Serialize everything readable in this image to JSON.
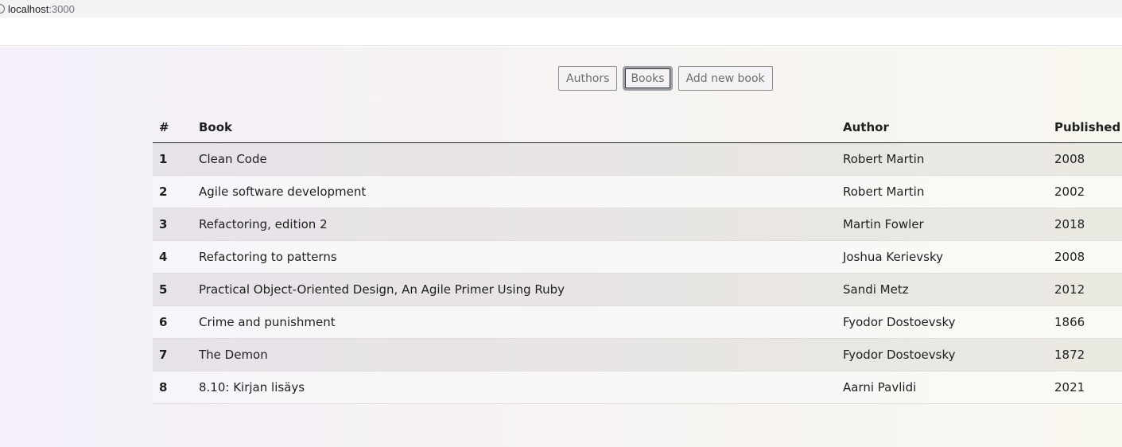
{
  "browser": {
    "url_host": "localhost",
    "url_port": ":3000"
  },
  "nav": {
    "authors_label": "Authors",
    "books_label": "Books",
    "add_book_label": "Add new book"
  },
  "table": {
    "headers": {
      "num": "#",
      "book": "Book",
      "author": "Author",
      "published": "Published"
    },
    "rows": [
      {
        "num": "1",
        "book": "Clean Code",
        "author": "Robert Martin",
        "published": "2008"
      },
      {
        "num": "2",
        "book": "Agile software development",
        "author": "Robert Martin",
        "published": "2002"
      },
      {
        "num": "3",
        "book": "Refactoring, edition 2",
        "author": "Martin Fowler",
        "published": "2018"
      },
      {
        "num": "4",
        "book": "Refactoring to patterns",
        "author": "Joshua Kerievsky",
        "published": "2008"
      },
      {
        "num": "5",
        "book": "Practical Object-Oriented Design, An Agile Primer Using Ruby",
        "author": "Sandi Metz",
        "published": "2012"
      },
      {
        "num": "6",
        "book": "Crime and punishment",
        "author": "Fyodor Dostoevsky",
        "published": "1866"
      },
      {
        "num": "7",
        "book": "The Demon",
        "author": "Fyodor Dostoevsky",
        "published": "1872"
      },
      {
        "num": "8",
        "book": "8.10: Kirjan lisäys",
        "author": "Aarni Pavlidi",
        "published": "2021"
      }
    ]
  }
}
